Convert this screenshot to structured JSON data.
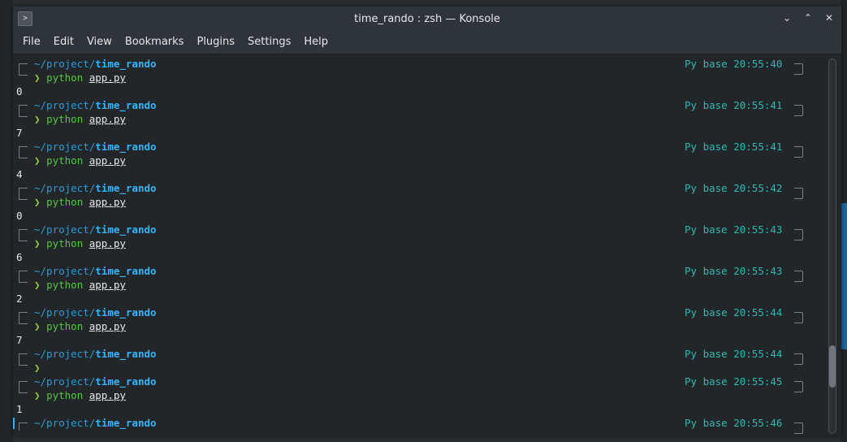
{
  "window": {
    "title": "time_rando : zsh — Konsole",
    "controls": {
      "minimize": "⌄",
      "maximize": "⌃",
      "close": "✕"
    }
  },
  "menu": [
    "File",
    "Edit",
    "View",
    "Bookmarks",
    "Plugins",
    "Settings",
    "Help"
  ],
  "prompt": {
    "path_prefix": "~/project/",
    "path_dir": "time_rando",
    "arrow": "❯",
    "status_label": "Py base"
  },
  "entries": [
    {
      "time": "20:55:40",
      "cmd": "python",
      "arg": "app.py",
      "output": "0"
    },
    {
      "time": "20:55:41",
      "cmd": "python",
      "arg": "app.py",
      "output": "7"
    },
    {
      "time": "20:55:41",
      "cmd": "python",
      "arg": "app.py",
      "output": "4"
    },
    {
      "time": "20:55:42",
      "cmd": "python",
      "arg": "app.py",
      "output": "0"
    },
    {
      "time": "20:55:43",
      "cmd": "python",
      "arg": "app.py",
      "output": "6"
    },
    {
      "time": "20:55:43",
      "cmd": "python",
      "arg": "app.py",
      "output": "2"
    },
    {
      "time": "20:55:44",
      "cmd": "python",
      "arg": "app.py",
      "output": "7"
    },
    {
      "time": "20:55:44",
      "cmd": "",
      "arg": "",
      "output": ""
    },
    {
      "time": "20:55:45",
      "cmd": "python",
      "arg": "app.py",
      "output": "1"
    },
    {
      "time": "20:55:46",
      "cmd": "",
      "arg": "",
      "output": ""
    }
  ],
  "colors": {
    "path": "#2a9bd6",
    "path_bold": "#2fb6ff",
    "status": "#2bb9b3",
    "arrow": "#8ed12e",
    "command": "#4fc93e",
    "background": "#232629"
  }
}
